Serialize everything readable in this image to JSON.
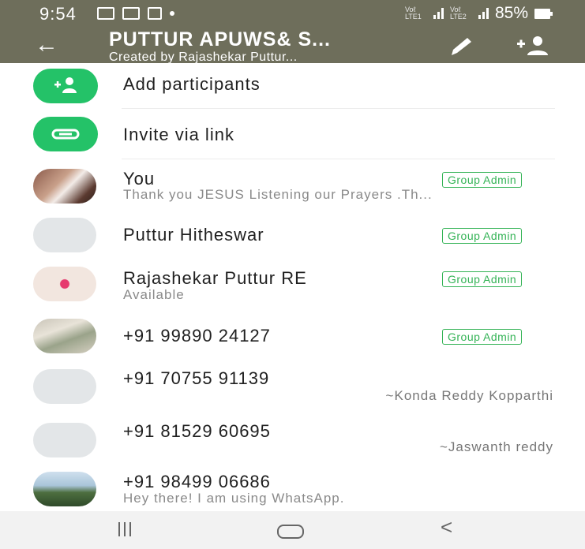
{
  "status_bar": {
    "time": "9:54",
    "signal_label_1": "Voℓ LTE1",
    "signal_label_2": "Voℓ LTE2",
    "battery": "85%"
  },
  "header": {
    "title": "PUTTUR APUWS& S...",
    "subtitle": "Created by Rajashekar Puttur..."
  },
  "actions": [
    {
      "label": "Add participants",
      "icon": "add-person-icon"
    },
    {
      "label": "Invite via link",
      "icon": "link-icon"
    }
  ],
  "participants": [
    {
      "name": "You",
      "status": "Thank you JESUS Listening our Prayers .Th...",
      "badge": "Group Admin",
      "push_name": "",
      "avatar": "photo"
    },
    {
      "name": "Puttur Hitheswar",
      "status": "",
      "badge": "Group Admin",
      "push_name": "",
      "avatar": "default"
    },
    {
      "name": "Rajashekar Puttur RE",
      "status": "Available",
      "badge": "Group Admin",
      "push_name": "",
      "avatar": "photo"
    },
    {
      "name": "+91 99890 24127",
      "status": "",
      "badge": "Group Admin",
      "push_name": "",
      "avatar": "photo"
    },
    {
      "name": "+91 70755 91139",
      "status": "",
      "badge": "",
      "push_name": "~Konda Reddy Kopparthi",
      "avatar": "default"
    },
    {
      "name": "+91 81529 60695",
      "status": "",
      "badge": "",
      "push_name": "~Jaswanth reddy",
      "avatar": "default"
    },
    {
      "name": "+91 98499 06686",
      "status": "Hey there! I am using WhatsApp.",
      "badge": "",
      "push_name": "",
      "avatar": "photo"
    }
  ],
  "colors": {
    "app_bar": "#6e6e5b",
    "accent_green": "#24c268",
    "admin_badge": "#34b356"
  }
}
